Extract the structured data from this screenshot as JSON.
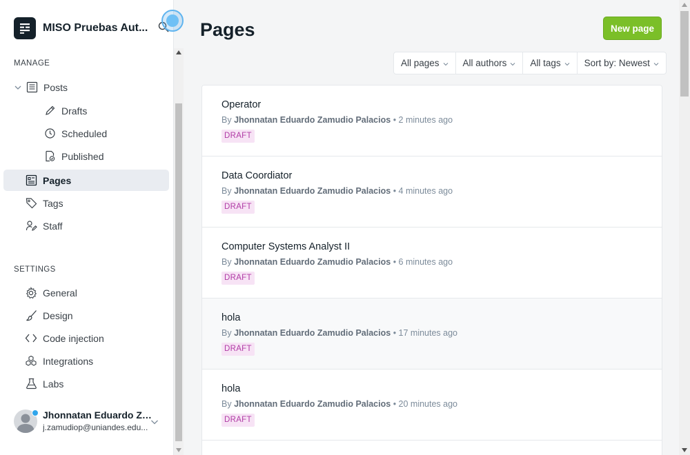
{
  "site": {
    "title": "MISO Pruebas Aut..."
  },
  "sidebar": {
    "manage_title": "MANAGE",
    "settings_title": "SETTINGS",
    "items": [
      {
        "label": "Posts",
        "icon": "posts-icon"
      },
      {
        "label": "Drafts",
        "icon": "pencil-icon"
      },
      {
        "label": "Scheduled",
        "icon": "clock-icon"
      },
      {
        "label": "Published",
        "icon": "published-icon"
      },
      {
        "label": "Pages",
        "icon": "pages-icon"
      },
      {
        "label": "Tags",
        "icon": "tag-icon"
      },
      {
        "label": "Staff",
        "icon": "staff-icon"
      }
    ],
    "settings_items": [
      {
        "label": "General",
        "icon": "gear-icon"
      },
      {
        "label": "Design",
        "icon": "brush-icon"
      },
      {
        "label": "Code injection",
        "icon": "code-icon"
      },
      {
        "label": "Integrations",
        "icon": "integrations-icon"
      },
      {
        "label": "Labs",
        "icon": "flask-icon"
      }
    ]
  },
  "user": {
    "name": "Jhonnatan Eduardo Za...",
    "email": "j.zamudiop@uniandes.edu..."
  },
  "main": {
    "title": "Pages",
    "new_button": "New page",
    "filters": [
      "All pages",
      "All authors",
      "All tags",
      "Sort by: Newest"
    ],
    "rows": [
      {
        "title": "Operator",
        "by": "By",
        "author": "Jhonnatan Eduardo Zamudio Palacios",
        "time": "• 2 minutes ago",
        "status": "DRAFT"
      },
      {
        "title": "Data Coordiator",
        "by": "By",
        "author": "Jhonnatan Eduardo Zamudio Palacios",
        "time": "• 4 minutes ago",
        "status": "DRAFT"
      },
      {
        "title": "Computer Systems Analyst II",
        "by": "By",
        "author": "Jhonnatan Eduardo Zamudio Palacios",
        "time": "• 6 minutes ago",
        "status": "DRAFT"
      },
      {
        "title": "hola",
        "by": "By",
        "author": "Jhonnatan Eduardo Zamudio Palacios",
        "time": "• 17 minutes ago",
        "status": "DRAFT"
      },
      {
        "title": "hola",
        "by": "By",
        "author": "Jhonnatan Eduardo Zamudio Palacios",
        "time": "• 20 minutes ago",
        "status": "DRAFT"
      }
    ]
  },
  "colors": {
    "accent_green": "#7bbf28",
    "draft_badge_bg": "#f7e3f5",
    "draft_badge_text": "#b03ba5",
    "active_nav_bg": "#e9ecf1"
  }
}
